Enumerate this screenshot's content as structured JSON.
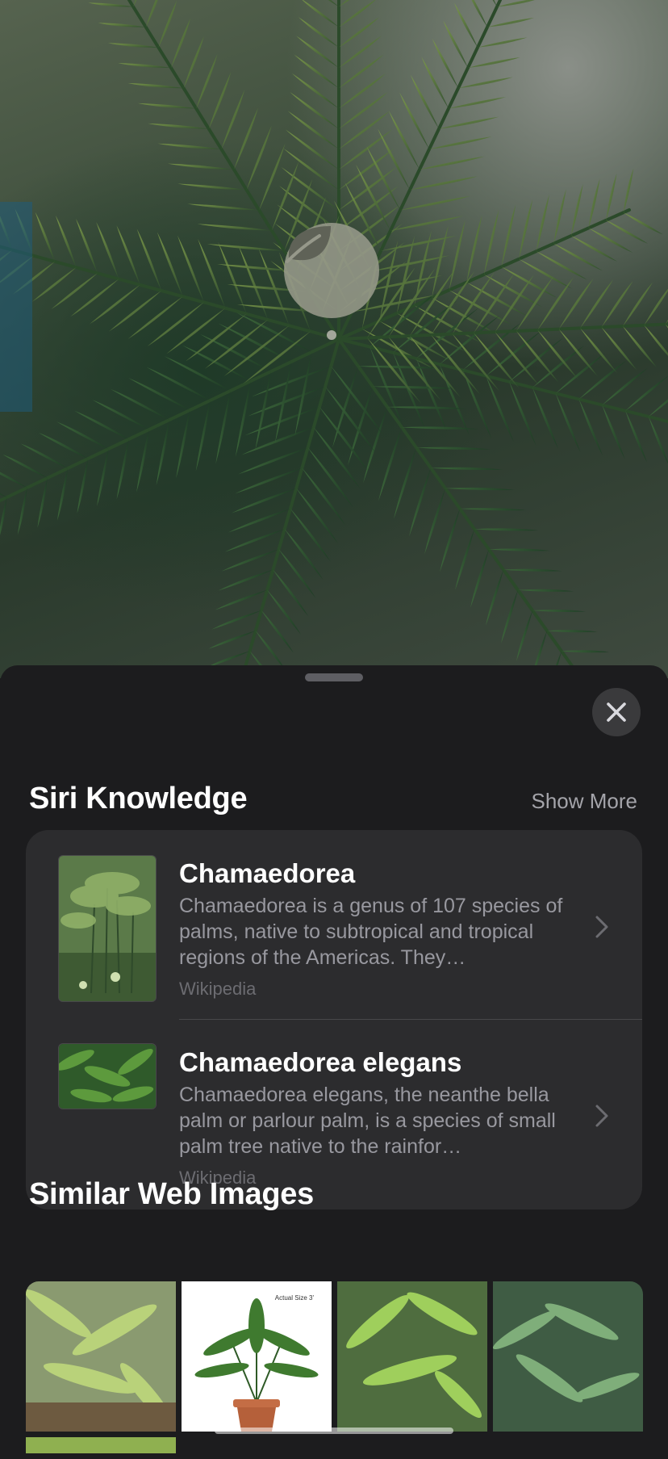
{
  "photo": {
    "subject_icon": "leaf-icon"
  },
  "sheet": {
    "close_icon": "close-icon",
    "siri_knowledge": {
      "title": "Siri Knowledge",
      "show_more_label": "Show More",
      "results": [
        {
          "title": "Chamaedorea",
          "description": "Chamaedorea is a genus of 107 species of palms, native to subtropical and tropical regions of the Americas. They…",
          "source": "Wikipedia"
        },
        {
          "title": "Chamaedorea elegans",
          "description": "Chamaedorea elegans, the neanthe bella palm or parlour palm, is a species of small palm tree native to the rainfor…",
          "source": "Wikipedia"
        }
      ]
    },
    "similar_web_images": {
      "title": "Similar Web Images",
      "images": [
        {
          "name": "palm-photo-1"
        },
        {
          "name": "potted-palm-photo",
          "caption": "Actual Size 3'"
        },
        {
          "name": "palm-photo-3"
        },
        {
          "name": "palm-photo-4"
        }
      ]
    }
  },
  "colors": {
    "sheet_background": "#1c1c1e",
    "card_background": "#2c2c2e",
    "primary_text": "#ffffff",
    "secondary_text": "#98989f",
    "tertiary_text": "#6c6c71"
  }
}
